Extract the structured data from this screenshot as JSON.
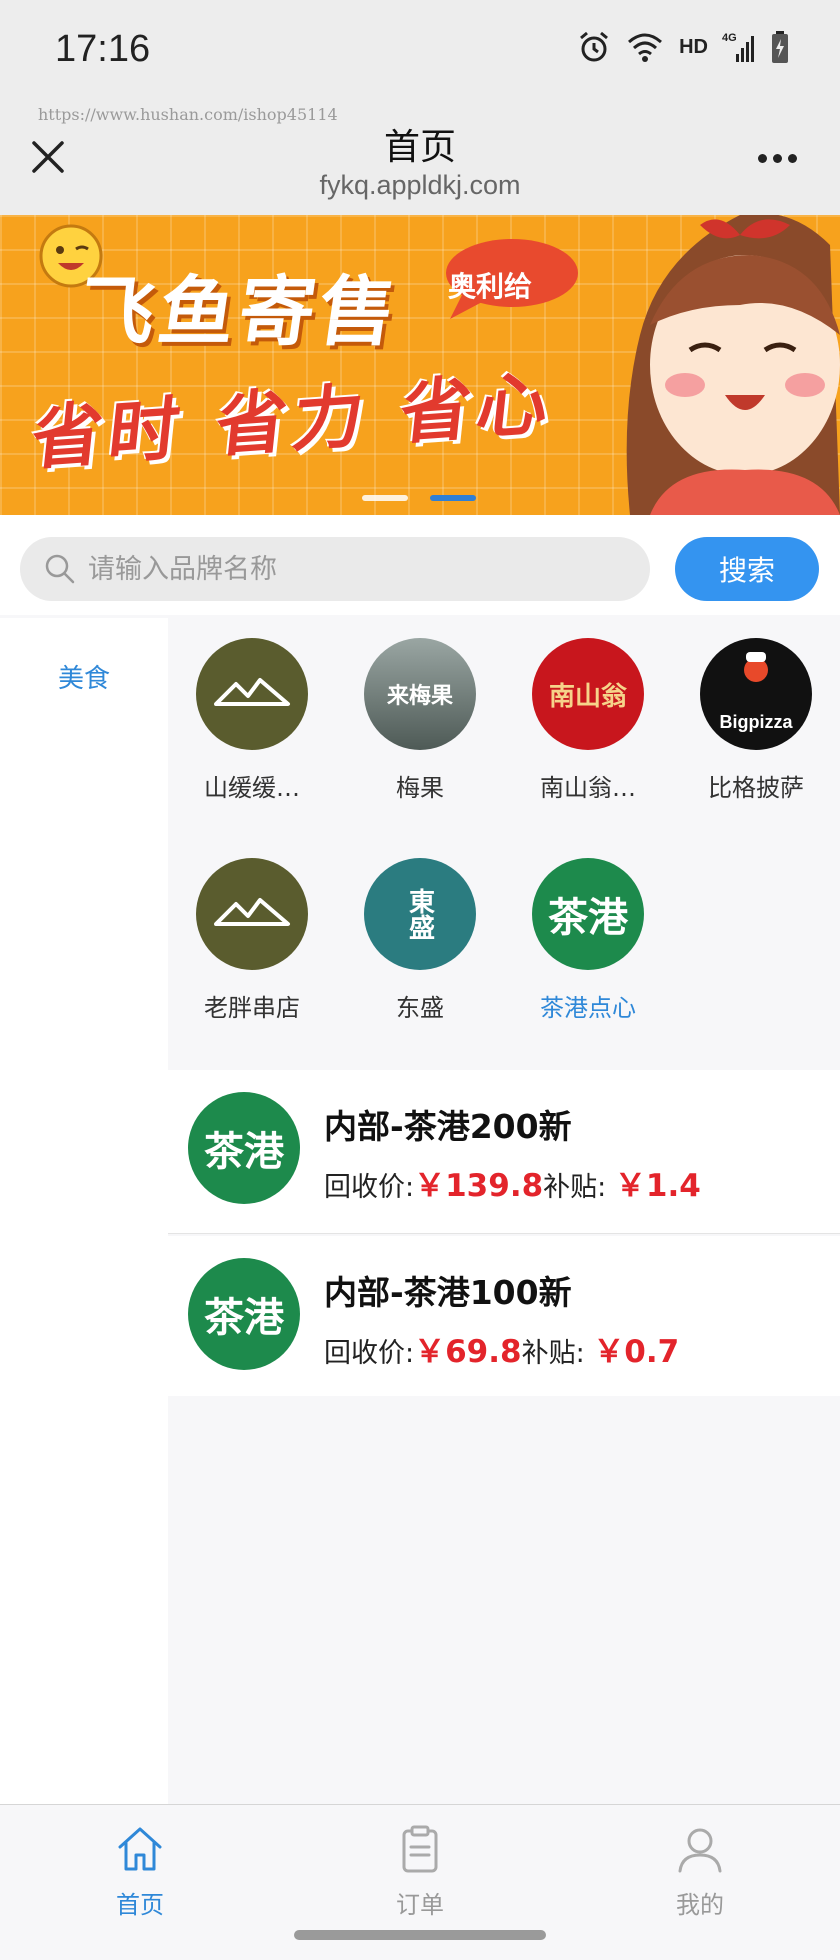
{
  "status_bar": {
    "time": "17:16",
    "network": "HD",
    "signal": "4G"
  },
  "titlebar": {
    "watermark": "https://www.hushan.com/ishop45114",
    "title": "首页",
    "domain": "fykq.appldkj.com"
  },
  "banner": {
    "title": "飞鱼寄售",
    "tag": "奥利给",
    "slogan": "省时 省力 省心",
    "slides": 2,
    "active_slide": 2
  },
  "search": {
    "placeholder": "请输入品牌名称",
    "button": "搜索"
  },
  "sidebar": {
    "items": [
      {
        "label": "美食",
        "active": true
      }
    ]
  },
  "brands": [
    {
      "name": "山缓缓…",
      "logo_text": "",
      "logo_color": "#5a5c2e"
    },
    {
      "name": "梅果",
      "logo_text": "来梅果",
      "logo_color": "#6e7a76"
    },
    {
      "name": "南山翁…",
      "logo_text": "南山翁",
      "logo_color": "#c8161d"
    },
    {
      "name": "比格披萨",
      "logo_text": "Bigpizza",
      "logo_color": "#111111"
    },
    {
      "name": "老胖串店",
      "logo_text": "",
      "logo_color": "#5a5c2e"
    },
    {
      "name": "东盛",
      "logo_text": "東盛",
      "logo_color": "#2b7c80"
    },
    {
      "name": "茶港点心",
      "logo_text": "茶港",
      "logo_color": "#1d8a4c",
      "active": true
    }
  ],
  "products": [
    {
      "name": "内部-茶港200新",
      "logo_text": "茶港",
      "price_label": "回收价:",
      "price": "￥139.8",
      "subsidy_label": "补贴:",
      "subsidy": "￥1.4"
    },
    {
      "name": "内部-茶港100新",
      "logo_text": "茶港",
      "price_label": "回收价:",
      "price": "￥69.8",
      "subsidy_label": "补贴:",
      "subsidy": "￥0.7"
    }
  ],
  "tabbar": {
    "tabs": [
      {
        "label": "首页",
        "icon": "home-icon",
        "active": true
      },
      {
        "label": "订单",
        "icon": "clipboard-icon",
        "active": false
      },
      {
        "label": "我的",
        "icon": "user-icon",
        "active": false
      }
    ]
  },
  "colors": {
    "accent": "#2f88d8",
    "search_button": "#3494f0",
    "price": "#e3242b",
    "banner_bg": "#f7a21d"
  }
}
